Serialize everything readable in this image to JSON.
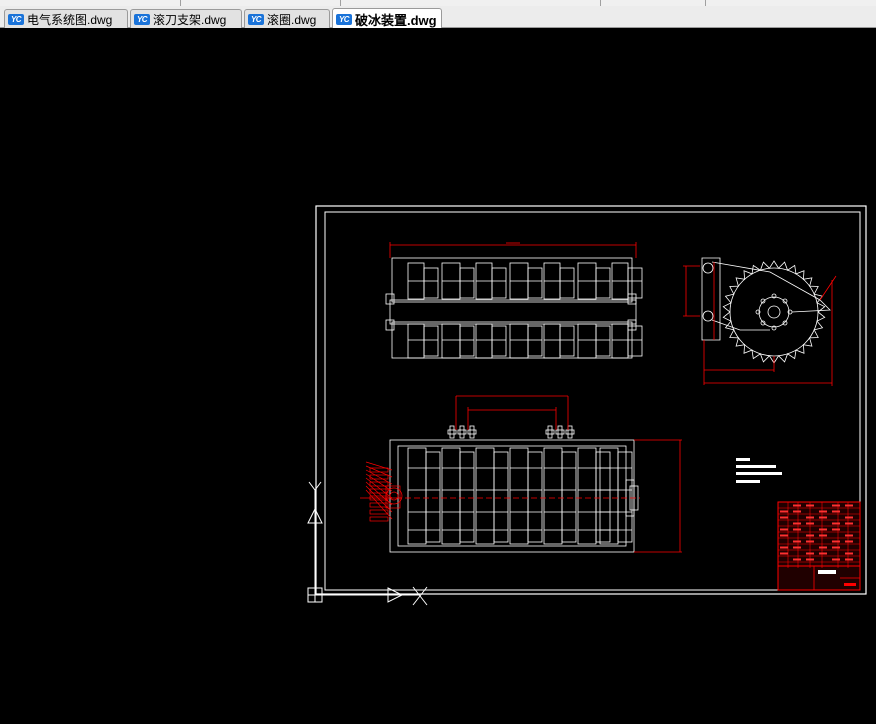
{
  "tabs": [
    {
      "label": "电气系统图.dwg",
      "icon": "yc-file-icon",
      "active": false
    },
    {
      "label": "滚刀支架.dwg",
      "icon": "yc-file-icon",
      "active": false
    },
    {
      "label": "滚圈.dwg",
      "icon": "yc-file-icon",
      "active": false
    },
    {
      "label": "破冰装置.dwg",
      "icon": "yc-file-icon",
      "active": true
    }
  ],
  "tab_icon_text": "YC",
  "colors": {
    "drawing_white": "#ffffff",
    "dimension_red": "#ff0000",
    "background": "#000000"
  }
}
